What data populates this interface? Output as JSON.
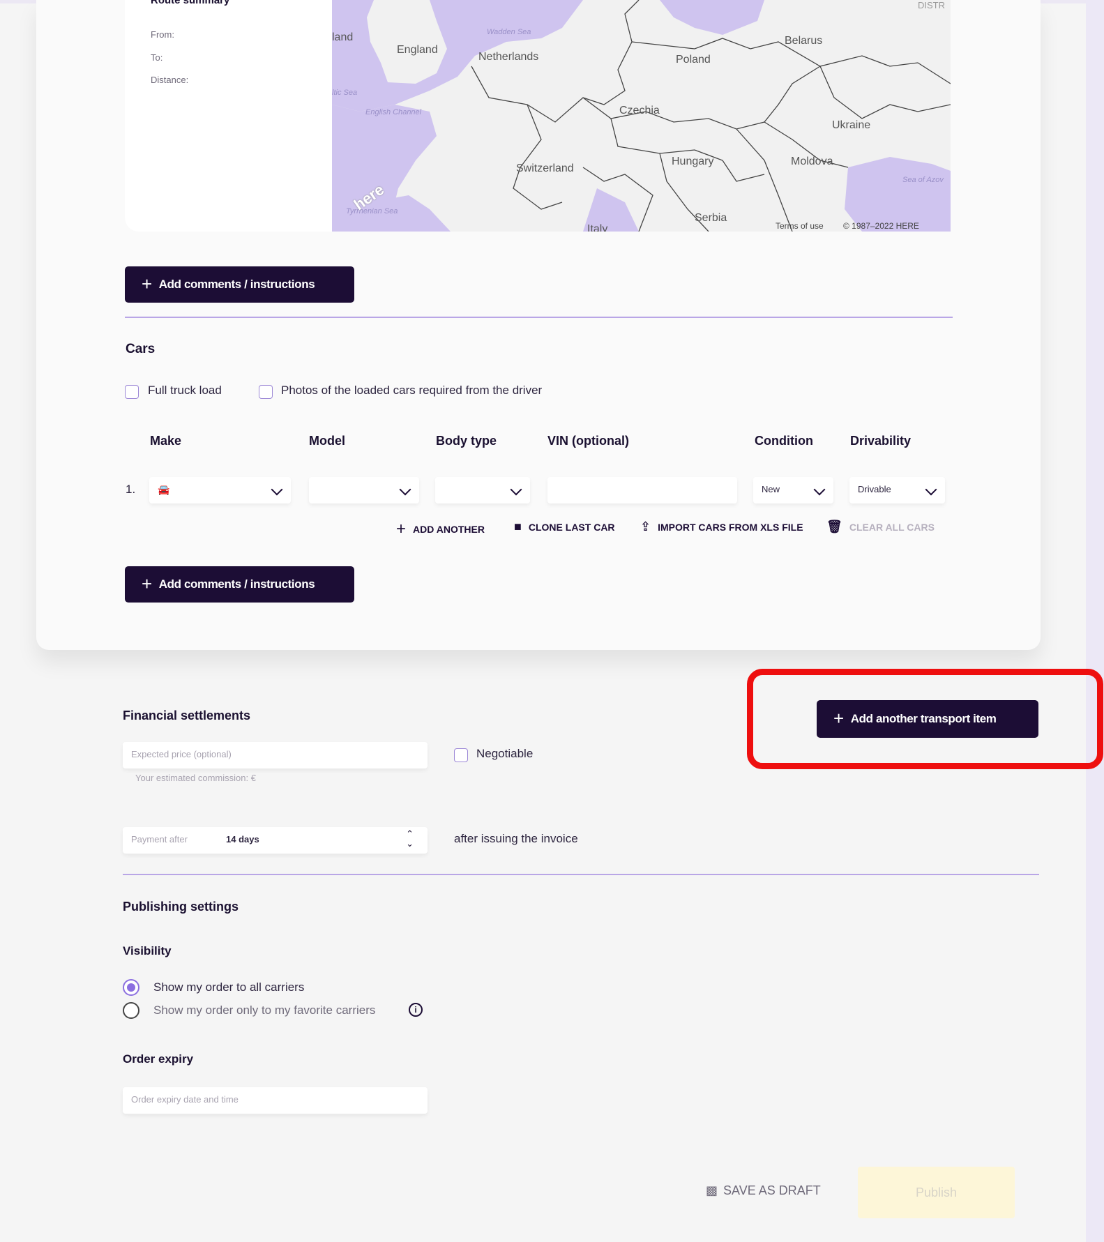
{
  "route_summary": {
    "title": "Route summary",
    "from_label": "From:",
    "to_label": "To:",
    "distance_label": "Distance:"
  },
  "map": {
    "countries": [
      "land",
      "England",
      "Netherlands",
      "Poland",
      "Belarus",
      "Czechia",
      "Ukraine",
      "Hungary",
      "Moldova",
      "Switzerland",
      "Serbia",
      "Italy",
      "DISTR"
    ],
    "seas": [
      "Wadden Sea",
      "ltic Sea",
      "English Channel",
      "Sea of Azov",
      "Tyrrhenian Sea"
    ],
    "logo": "here",
    "terms": "Terms of use",
    "copyright": "© 1987–2022 HERE"
  },
  "add_comments_label": "Add comments / instructions",
  "cars": {
    "title": "Cars",
    "full_truck_load": "Full truck load",
    "photos_required": "Photos of the loaded cars required from the driver",
    "columns": [
      "Make",
      "Model",
      "Body type",
      "VIN (optional)",
      "Condition",
      "Drivability"
    ],
    "row": {
      "index": "1.",
      "make": "",
      "model": "",
      "body_type": "",
      "vin": "",
      "condition": "New",
      "drivability": "Drivable"
    },
    "actions": {
      "add_another": "ADD ANOTHER",
      "clone_last": "CLONE LAST CAR",
      "import_xls": "IMPORT CARS FROM XLS FILE",
      "clear_all": "CLEAR ALL CARS"
    }
  },
  "financial": {
    "title": "Financial settlements",
    "expected_price_placeholder": "Expected price (optional)",
    "commission": "Your estimated commission: €",
    "negotiable": "Negotiable",
    "payment_label": "Payment after",
    "payment_value": "14 days",
    "payment_suffix": "after issuing the invoice"
  },
  "add_transport_item": "Add another transport item",
  "publishing": {
    "title": "Publishing settings",
    "visibility_title": "Visibility",
    "option_all": "Show my order to all carriers",
    "option_favorites": "Show my order only to my favorite carriers",
    "selected": "all"
  },
  "order_expiry": {
    "title": "Order expiry",
    "placeholder": "Order expiry date and time"
  },
  "footer": {
    "save_draft": "SAVE AS DRAFT",
    "publish": "Publish"
  },
  "colors": {
    "accent_dark": "#1c0d35",
    "accent_purple": "#8c6fe0",
    "highlight_red": "#ee0f0f"
  }
}
